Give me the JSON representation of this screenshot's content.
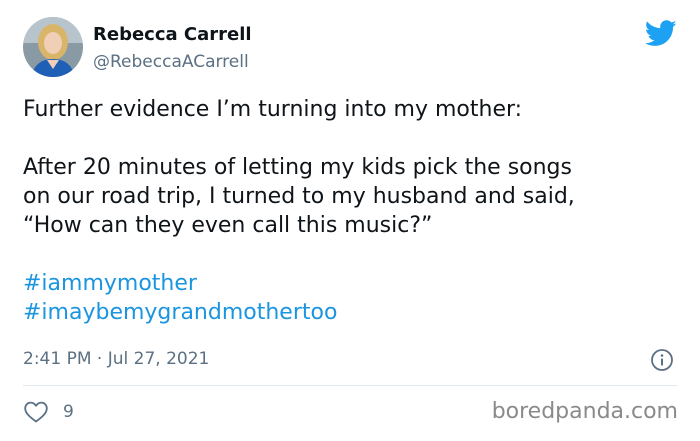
{
  "author": {
    "display_name": "Rebecca Carrell",
    "handle": "@RebeccaACarrell"
  },
  "tweet": {
    "line1": "Further evidence I’m turning into my mother:",
    "line2": "After 20 minutes of letting my kids pick the songs",
    "line3": "on our road trip, I turned to my husband and said,",
    "line4": "“How can they even call this music?”",
    "hashtags": [
      "#iammymother",
      "#imaybemygrandmothertoo"
    ]
  },
  "meta": {
    "timestamp": "2:41 PM · Jul 27, 2021",
    "like_count": "9"
  },
  "watermark": "boredpanda.com",
  "colors": {
    "twitter_blue": "#1da1f2",
    "hashtag": "#1b95e0",
    "muted": "#5b7083"
  },
  "icons": [
    "twitter-bird-icon",
    "info-icon",
    "heart-icon"
  ]
}
